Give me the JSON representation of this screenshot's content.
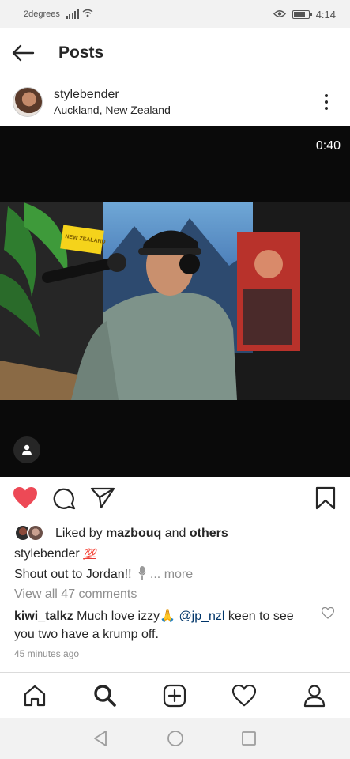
{
  "status_bar": {
    "carrier": "2degrees",
    "time": "4:14",
    "icons": [
      "signal-icon",
      "wifi-icon",
      "eye-icon",
      "battery-icon"
    ]
  },
  "header": {
    "title": "Posts",
    "back_icon": "arrow-left-icon"
  },
  "post": {
    "username": "stylebender",
    "location": "Auckland, New Zealand",
    "video_duration": "0:40",
    "sign_text": "NEW ZEALAND",
    "liked": true,
    "likes": {
      "prefix": "Liked by ",
      "user": "mazbouq",
      "connector": " and ",
      "others": "others"
    },
    "caption": {
      "username": "stylebender",
      "emoji": "💯",
      "text": "Shout out to Jordan!! ",
      "more": "more"
    },
    "view_all_comments": "View all 47 comments",
    "comment": {
      "username": "kiwi_talkz",
      "text_before": " Much love izzy🙏 ",
      "mention": "@jp_nzl",
      "text_after": " keen to see you two have a krump off."
    },
    "timestamp": "45 minutes ago"
  },
  "colors": {
    "like_red": "#ed4956",
    "text": "#262626",
    "muted": "#8e8e8e",
    "mention": "#003569"
  },
  "bottom_nav": [
    "home-icon",
    "search-icon",
    "add-post-icon",
    "activity-heart-icon",
    "profile-icon"
  ],
  "system_nav": [
    "back-triangle-icon",
    "home-circle-icon",
    "recents-square-icon"
  ]
}
